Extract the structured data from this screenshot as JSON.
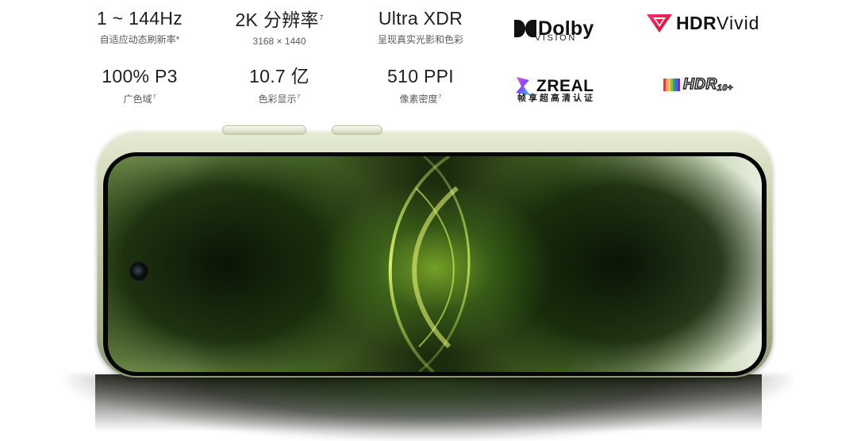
{
  "specs": [
    {
      "value": "1 ~ 144Hz",
      "sub": "自适应动态刷新率*"
    },
    {
      "value": "2K 分辨率",
      "value_sup": "7",
      "sub": "3168 × 1440"
    },
    {
      "value": "Ultra XDR",
      "sub": "呈现真实光影和色彩"
    },
    {
      "value": "100% P3",
      "sub": "广色域",
      "sub_sup": "7"
    },
    {
      "value": "10.7 亿",
      "sub": "色彩显示",
      "sub_sup": "7"
    },
    {
      "value": "510 PPI",
      "sub": "像素密度",
      "sub_sup": "7"
    }
  ],
  "logos": {
    "dolby": {
      "word": "Dolby",
      "sub": "VISION",
      "icon": "dolby-double-d-icon"
    },
    "hdr_vivid": {
      "bold": "HDR",
      "thin": "Vivid",
      "icon": "hdr-vivid-v-icon"
    },
    "zreal": {
      "word": "ZREAL",
      "sub": "帧享超高清认证",
      "icon": "zreal-prism-icon"
    },
    "hdr10plus": {
      "word": "HDR",
      "small": "10+",
      "icon": "hdr10-rainbow-icon"
    }
  },
  "colors": {
    "screen_green": "#6b8f3a",
    "glow_yellow": "#d6ff4a",
    "frame_green": "#c7d1ad"
  }
}
